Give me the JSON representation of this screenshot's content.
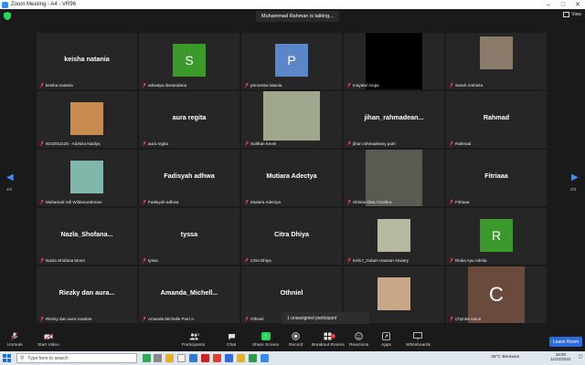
{
  "window": {
    "title": "Zoom Meeting - A4 - VR96"
  },
  "topbar": {
    "talking": "Muhammad Rahman is talking...",
    "view_label": "View"
  },
  "pagination": {
    "left": "2/2",
    "right": "2/2"
  },
  "tiles": [
    {
      "bigname": "keisha natania",
      "label": "keisha natania"
    },
    {
      "avatar": "S",
      "avatar_color": "#3b9a2b",
      "label": "adisatya dewandana"
    },
    {
      "avatar": "P",
      "avatar_color": "#5b86c9",
      "label": "princessa latania"
    },
    {
      "photo": true,
      "photo_color": "#000000",
      "label": "Inayatul Azqia"
    },
    {
      "photo": true,
      "photo_color": "#8a7b6a",
      "label": "Sarah Arshinta"
    },
    {
      "photo": true,
      "photo_color": "#c98a4d",
      "label": "9222011126 - Adzkira Nadiya"
    },
    {
      "bigname": "aura regita",
      "label": "aura regita"
    },
    {
      "photo": true,
      "photo_color": "#9fa88d",
      "label": "Sulthan Kevin"
    },
    {
      "bigname": "jihan_rahmadean...",
      "label": "jihan rahmadeany putri"
    },
    {
      "bigname": "Rahmad",
      "label": "Rahmad"
    },
    {
      "photo": true,
      "photo_color": "#7fb8aa",
      "label": "Muhamad rafi Wildanurahman"
    },
    {
      "bigname": "Fadisyah adhwa",
      "label": "Fadisyah adhwa"
    },
    {
      "bigname": "Mutiara Adectya",
      "label": "Mutiara Adectya"
    },
    {
      "photo": true,
      "photo_color": "#5a5a52",
      "label": "Shintia Diva Azzahra"
    },
    {
      "bigname": "Fitriaaa",
      "label": "Fitriaaa"
    },
    {
      "bigname": "Nazla_Shofana...",
      "label": "Nazla Shofana Monri"
    },
    {
      "bigname": "tyssa",
      "label": "tyssa"
    },
    {
      "bigname": "Citra Dhiya",
      "label": "Citra Dhiya"
    },
    {
      "photo": true,
      "photo_color": "#b7b8a0",
      "label": "Kel17_Gulam Hassan Anwary"
    },
    {
      "avatar": "R",
      "avatar_color": "#3b9a2b",
      "label": "Rioka Ayu Adelia"
    },
    {
      "bigname": "Riezky dan aura...",
      "label": "Riezky dan aura rosaline"
    },
    {
      "bigname": "Amanda_Michell...",
      "label": "Amanda Michelle Putri A."
    },
    {
      "bigname": "Othniel",
      "label": "Othniel"
    },
    {
      "photo": true,
      "photo_color": "#c9a88a",
      "label": ""
    },
    {
      "avatar": "C",
      "avatar_color": "#6b4a3e",
      "label": "Chyntia Ainun"
    }
  ],
  "toast": {
    "text": "1 unassigned participant"
  },
  "toolbar": {
    "unmute": "Unmute",
    "start_video": "Start Video",
    "participants": "Participants",
    "participants_count": "44",
    "chat": "Chat",
    "share": "Share Screen",
    "record": "Record",
    "breakout": "Breakout Rooms",
    "breakout_badge": "1",
    "reactions": "Reactions",
    "apps": "Apps",
    "whiteboards": "Whiteboards",
    "leave": "Leave Room"
  },
  "taskbar": {
    "search_placeholder": "Type here to search",
    "weather": "29°C  Berawan",
    "time": "18:50",
    "date": "11/22/2022"
  }
}
